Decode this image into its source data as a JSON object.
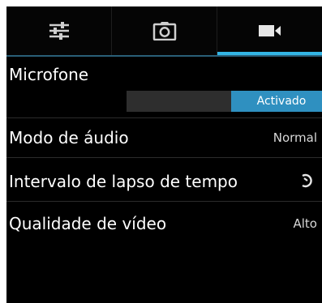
{
  "tabs": [
    {
      "icon": "sliders-icon",
      "selected": false
    },
    {
      "icon": "camera-icon",
      "selected": false
    },
    {
      "icon": "video-camera-icon",
      "selected": true
    }
  ],
  "settings": {
    "microphone": {
      "label": "Microfone",
      "toggle_on_label": "Activado",
      "state": "on"
    },
    "audio_mode": {
      "label": "Modo de áudio",
      "value": "Normal"
    },
    "time_lapse": {
      "label": "Intervalo de lapso de tempo",
      "icon": "timer-icon"
    },
    "video_quality": {
      "label": "Qualidade de vídeo",
      "value": "Alto"
    }
  },
  "colors": {
    "accent": "#33b5e5",
    "toggle_on": "#2f90c0",
    "background": "#000000"
  }
}
